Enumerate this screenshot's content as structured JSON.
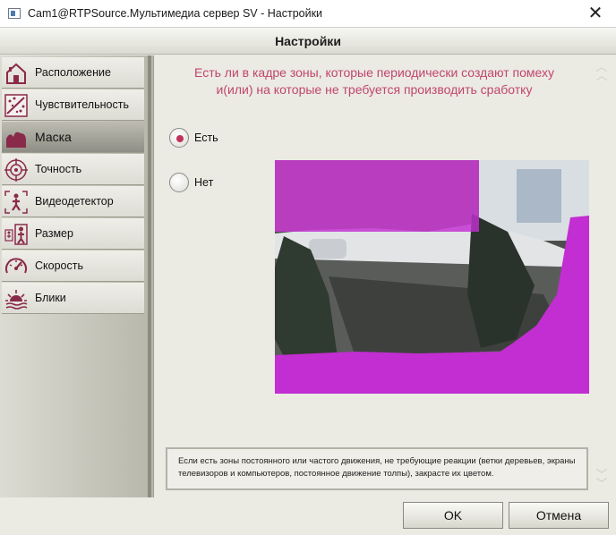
{
  "window": {
    "title": "Cam1@RTPSource.Мультимедиа сервер SV - Настройки",
    "close_symbol": "✕"
  },
  "header": {
    "title": "Настройки"
  },
  "sidebar": {
    "items": [
      {
        "label": "Расположение",
        "icon": "house-icon"
      },
      {
        "label": "Чувствительность",
        "icon": "sensitivity-icon"
      },
      {
        "label": "Маска",
        "icon": "mask-icon",
        "active": true
      },
      {
        "label": "Точность",
        "icon": "target-icon"
      },
      {
        "label": "Видеодетектор",
        "icon": "person-detector-icon"
      },
      {
        "label": "Размер",
        "icon": "size-icon"
      },
      {
        "label": "Скорость",
        "icon": "speedometer-icon"
      },
      {
        "label": "Блики",
        "icon": "sun-glare-icon"
      }
    ]
  },
  "main": {
    "question_line1": "Есть ли в кадре зоны, которые периодически создают помеху",
    "question_line2": "и(или) на которые не требуется производить сработку",
    "options": [
      {
        "label": "Есть",
        "selected": true
      },
      {
        "label": "Нет",
        "selected": false
      }
    ],
    "info_text": "Если есть зоны постоянного или частого движения, не требующие реакции (ветки деревьев, экраны телевизоров и компьютеров, постоянное движение толпы), закрасте их цветом.",
    "mask_color": "#c22ed1",
    "accent_color": "#c0466e"
  },
  "footer": {
    "ok_label": "OK",
    "cancel_label": "Отмена"
  }
}
